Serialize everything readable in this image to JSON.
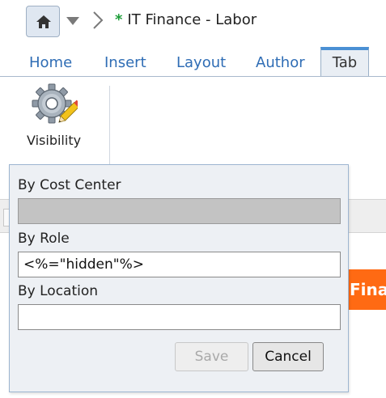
{
  "header": {
    "breadcrumb_title": "IT Finance - Labor",
    "modified_marker": "*",
    "home_icon": "home-icon",
    "accent_color": "#2f6db5"
  },
  "tabs": [
    {
      "label": "Home",
      "active": false
    },
    {
      "label": "Insert",
      "active": false
    },
    {
      "label": "Layout",
      "active": false
    },
    {
      "label": "Author",
      "active": false
    },
    {
      "label": "Tab",
      "active": true
    }
  ],
  "ribbon": {
    "visibility_label": "Visibility",
    "visibility_icon": "gear-pencil-icon"
  },
  "background": {
    "orange_bar_text": "Fina",
    "orange_color": "#ff6a13"
  },
  "visibility_panel": {
    "cost_center": {
      "label": "By Cost Center",
      "value": "",
      "disabled": true
    },
    "role": {
      "label": "By Role",
      "value": "<%=\"hidden\"%>"
    },
    "location": {
      "label": "By Location",
      "value": ""
    },
    "save_label": "Save",
    "cancel_label": "Cancel"
  }
}
